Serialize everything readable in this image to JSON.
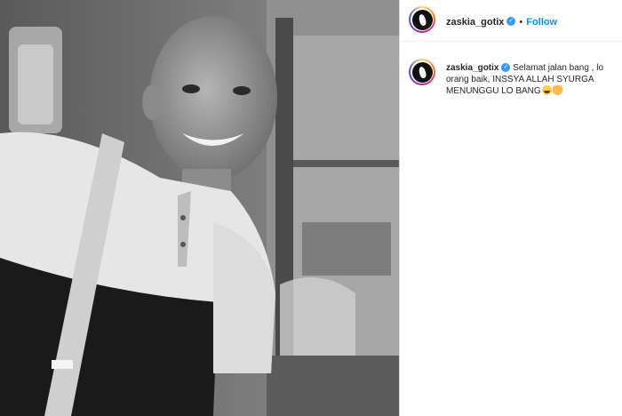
{
  "post": {
    "username": "zaskia_gotix",
    "verified": true,
    "follow_label": "Follow",
    "separator": "•"
  },
  "comment": {
    "username": "zaskia_gotix",
    "text": "Selamat jalan bang , lo orang baik, INSSYA ALLAH SYURGA MENUNGGU LO BANG",
    "emojis": [
      "crying-face-emoji",
      "praying-hands-emoji"
    ]
  },
  "colors": {
    "follow": "#0095f6",
    "verified": "#3897f0",
    "text": "#262626"
  }
}
